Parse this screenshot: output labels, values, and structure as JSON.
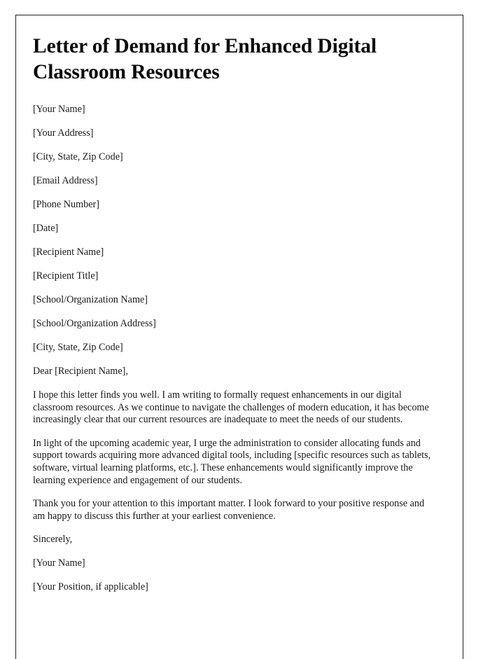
{
  "document": {
    "title": "Letter of Demand for Enhanced Digital Classroom Resources",
    "border_color": "#231f20",
    "text_color": "#1a1a1a",
    "page_background": "#ffffff",
    "sender_block": [
      "[Your Name]",
      "[Your Address]",
      "[City, State, Zip Code]",
      "[Email Address]",
      "[Phone Number]"
    ],
    "date_line": "[Date]",
    "recipient_block": [
      "[Recipient Name]",
      "[Recipient Title]",
      "[School/Organization Name]",
      "[School/Organization Address]",
      "[City, State, Zip Code]"
    ],
    "salutation": "Dear [Recipient Name],",
    "paragraphs": [
      "I hope this letter finds you well. I am writing to formally request enhancements in our digital classroom resources. As we continue to navigate the challenges of modern education, it has become increasingly clear that our current resources are inadequate to meet the needs of our students.",
      "In light of the upcoming academic year, I urge the administration to consider allocating funds and support towards acquiring more advanced digital tools, including [specific resources such as tablets, software, virtual learning platforms, etc.]. These enhancements would significantly improve the learning experience and engagement of our students.",
      "Thank you for your attention to this important matter. I look forward to your positive response and am happy to discuss this further at your earliest convenience."
    ],
    "closing": "Sincerely,",
    "signature_block": [
      "[Your Name]",
      "[Your Position, if applicable]"
    ]
  }
}
